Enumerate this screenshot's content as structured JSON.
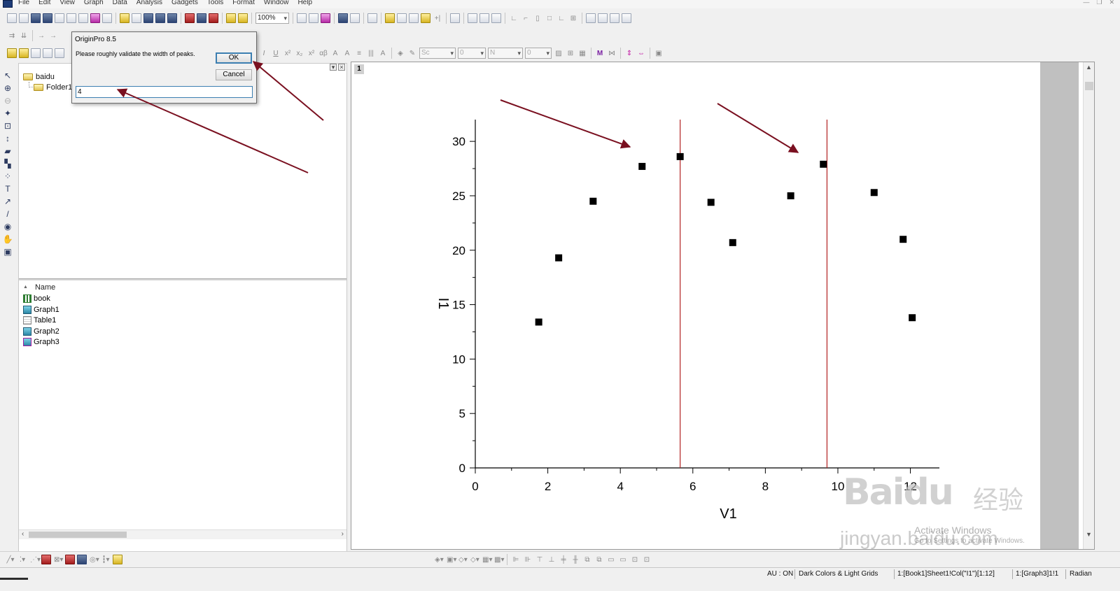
{
  "menubar": {
    "items": [
      "File",
      "Edit",
      "View",
      "Graph",
      "Data",
      "Analysis",
      "Gadgets",
      "Tools",
      "Format",
      "Window",
      "Help"
    ],
    "window_controls": [
      "—",
      "❐",
      "✕"
    ]
  },
  "toolbar": {
    "zoom_value": "100%",
    "line_style_value": "Sc",
    "line_width_value": "0",
    "fill_pattern_value": "N",
    "pattern_width_value": "0"
  },
  "dialog": {
    "title": "OriginPro 8.5",
    "message": "Please roughly validate the width of peaks.",
    "ok_label": "OK",
    "cancel_label": "Cancel",
    "input_value": "4"
  },
  "project_explorer": {
    "root_folder": "baidu",
    "sub_folder": "Folder1",
    "column_header": "Name",
    "items": [
      {
        "name": "book",
        "icon": "workbook-icon"
      },
      {
        "name": "Graph1",
        "icon": "graph-icon"
      },
      {
        "name": "Table1",
        "icon": "table-icon"
      },
      {
        "name": "Graph2",
        "icon": "graph-icon"
      },
      {
        "name": "Graph3",
        "icon": "graph-icon"
      }
    ]
  },
  "graph": {
    "layer_label": "1",
    "xlabel": "V1",
    "ylabel": "I1",
    "xlim": [
      0,
      12.8
    ],
    "ylim": [
      0,
      32
    ],
    "x_ticks": [
      0,
      2,
      4,
      6,
      8,
      10,
      12
    ],
    "y_ticks": [
      0,
      5,
      10,
      15,
      20,
      25,
      30
    ],
    "points": [
      {
        "x": 1.75,
        "y": 13.4
      },
      {
        "x": 2.3,
        "y": 19.3
      },
      {
        "x": 3.25,
        "y": 24.5
      },
      {
        "x": 4.6,
        "y": 27.7
      },
      {
        "x": 5.65,
        "y": 28.6
      },
      {
        "x": 6.5,
        "y": 24.4
      },
      {
        "x": 7.1,
        "y": 20.7
      },
      {
        "x": 8.7,
        "y": 25.0
      },
      {
        "x": 9.6,
        "y": 27.9
      },
      {
        "x": 11.0,
        "y": 25.3
      },
      {
        "x": 11.8,
        "y": 21.0
      },
      {
        "x": 12.05,
        "y": 13.8
      }
    ],
    "peak_lines_x": [
      5.65,
      9.7
    ],
    "colors": {
      "points": "#000000",
      "peak_lines": "#b22222",
      "annotation_arrows": "#7a1020"
    }
  },
  "watermark": {
    "brand": "Baidu",
    "brand_cn": "经验",
    "url": "jingyan.baidu.com",
    "activate_title": "Activate Windows",
    "activate_sub": "Go to Settings to activate Windows."
  },
  "status": {
    "au": "AU : ON",
    "theme": "Dark Colors & Light Grids",
    "cell_ref": "1:[Book1]Sheet1!Col(\"I1\")[1:12]",
    "graph_ref": "1:[Graph3]1!1",
    "angle": "Radian"
  }
}
